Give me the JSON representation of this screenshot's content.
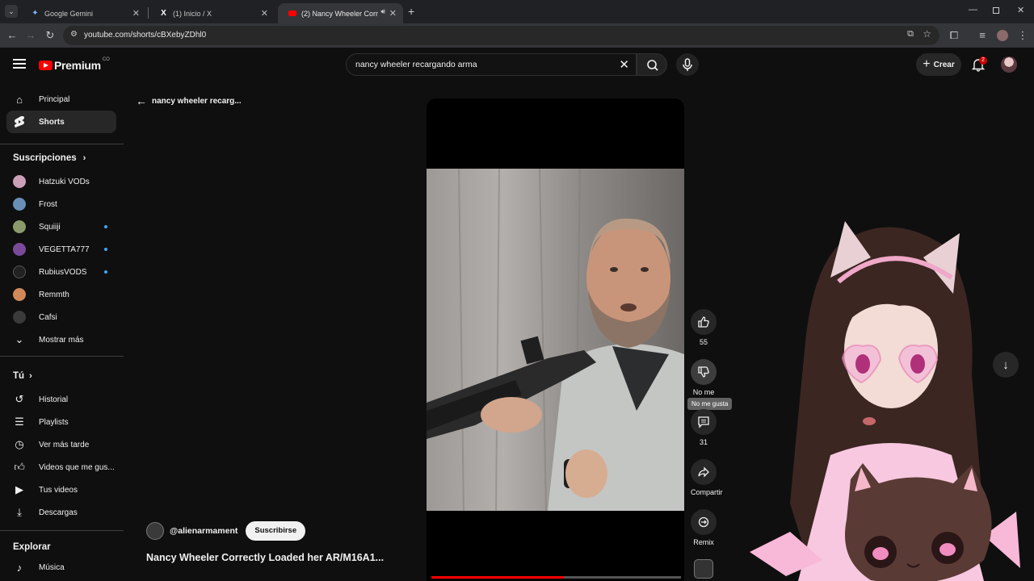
{
  "browser": {
    "tabs": [
      {
        "title": "Google Gemini",
        "favicon": "gemini-icon"
      },
      {
        "title": "(1) Inicio / X",
        "favicon": "x-icon"
      },
      {
        "title": "(2) Nancy Wheeler Correctly",
        "favicon": "youtube-icon",
        "active": true
      }
    ],
    "url": "youtube.com/shorts/cBXebyZDhl0"
  },
  "masthead": {
    "logo_text": "Premium",
    "logo_super": "CO",
    "search_query": "nancy wheeler recargando arma",
    "create_label": "Crear",
    "notif_count": "2"
  },
  "sidebar": {
    "main": [
      {
        "label": "Principal",
        "icon": "home-icon"
      },
      {
        "label": "Shorts",
        "icon": "shorts-icon",
        "selected": true
      }
    ],
    "subs_header": "Suscripciones",
    "subscriptions": [
      {
        "label": "Hatzuki VODs",
        "color": "#c9a0b8",
        "dot": false
      },
      {
        "label": "Frost",
        "color": "#6a8fb5",
        "dot": false
      },
      {
        "label": "Squiiji",
        "color": "#8a9a6a",
        "dot": true
      },
      {
        "label": "VEGETTA777",
        "color": "#7a4a9a",
        "dot": true
      },
      {
        "label": "RubiusVODS",
        "color": "#222222",
        "dot": true
      },
      {
        "label": "Remmth",
        "color": "#d08a5a",
        "dot": false
      },
      {
        "label": "Cafsi",
        "color": "#3a3a3a",
        "dot": false
      }
    ],
    "show_more": "Mostrar más",
    "you_header": "Tú",
    "you_items": [
      {
        "label": "Historial",
        "icon": "history-icon"
      },
      {
        "label": "Playlists",
        "icon": "playlists-icon"
      },
      {
        "label": "Ver más tarde",
        "icon": "clock-icon"
      },
      {
        "label": "Videos que me gus...",
        "icon": "like-icon"
      },
      {
        "label": "Tus videos",
        "icon": "video-icon"
      },
      {
        "label": "Descargas",
        "icon": "download-icon"
      }
    ],
    "explore_header": "Explorar",
    "explore_items": [
      {
        "label": "Música",
        "icon": "music-icon"
      }
    ]
  },
  "shorts": {
    "back_title": "nancy wheeler recarg...",
    "channel": "@alienarmament",
    "subscribe": "Suscribirse",
    "title": "Nancy Wheeler Correctly Loaded her AR/M16A1...",
    "progress": 0.53,
    "actions": {
      "likes": "55",
      "dislike_label": "No me",
      "dislike_tooltip": "No me gusta",
      "comments": "31",
      "share": "Compartir",
      "remix": "Remix"
    }
  }
}
